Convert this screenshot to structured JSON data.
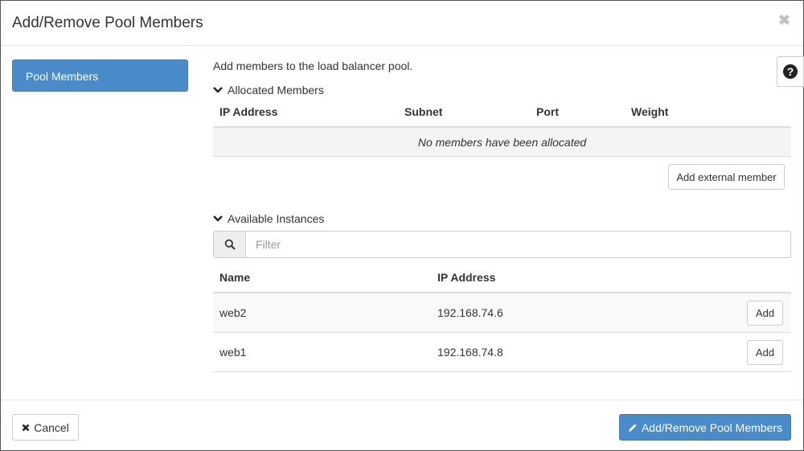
{
  "modal": {
    "title": "Add/Remove Pool Members",
    "close_symbol": "✖"
  },
  "sidebar": {
    "items": [
      {
        "label": "Pool Members",
        "active": true
      }
    ]
  },
  "help": {
    "symbol": "?",
    "icon": "question-circle-icon"
  },
  "main": {
    "intro": "Add members to the load balancer pool.",
    "allocated": {
      "heading": "Allocated Members",
      "columns": [
        "IP Address",
        "Subnet",
        "Port",
        "Weight"
      ],
      "empty_message": "No members have been allocated",
      "add_external_label": "Add external member"
    },
    "available": {
      "heading": "Available Instances",
      "filter_placeholder": "Filter",
      "filter_value": "",
      "columns": [
        "Name",
        "IP Address"
      ],
      "rows": [
        {
          "name": "web2",
          "ip": "192.168.74.6",
          "action": "Add"
        },
        {
          "name": "web1",
          "ip": "192.168.74.8",
          "action": "Add"
        }
      ]
    }
  },
  "footer": {
    "cancel_label": "Cancel",
    "submit_label": "Add/Remove Pool Members"
  },
  "colors": {
    "primary": "#4a8bc9",
    "border": "#dddddd",
    "muted_background": "#f4f4f4"
  }
}
